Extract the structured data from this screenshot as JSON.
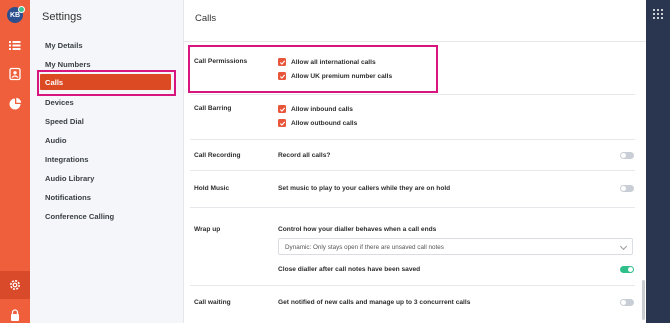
{
  "user": {
    "initials": "KB"
  },
  "rail": {
    "icons": [
      "list-icon",
      "contacts-icon",
      "analytics-icon",
      "settings-icon",
      "lock-icon"
    ]
  },
  "sidebar": {
    "title": "Settings",
    "items": [
      {
        "label": "My Details"
      },
      {
        "label": "My Numbers"
      },
      {
        "label": "Calls",
        "active": true
      },
      {
        "label": "Devices"
      },
      {
        "label": "Speed Dial"
      },
      {
        "label": "Audio"
      },
      {
        "label": "Integrations"
      },
      {
        "label": "Audio Library"
      },
      {
        "label": "Notifications"
      },
      {
        "label": "Conference Calling"
      }
    ]
  },
  "main": {
    "title": "Calls",
    "sections": {
      "permissions": {
        "label": "Call Permissions",
        "options": [
          {
            "label": "Allow all international calls",
            "checked": true
          },
          {
            "label": "Allow UK premium number calls",
            "checked": true
          }
        ]
      },
      "barring": {
        "label": "Call Barring",
        "options": [
          {
            "label": "Allow inbound calls",
            "checked": true
          },
          {
            "label": "Allow outbound calls",
            "checked": true
          }
        ]
      },
      "recording": {
        "label": "Call Recording",
        "description": "Record all calls?",
        "enabled": false
      },
      "hold_music": {
        "label": "Hold Music",
        "description": "Set music to play to your callers while they are on hold",
        "enabled": false
      },
      "wrap_up": {
        "label": "Wrap up",
        "description": "Control how your dialler behaves when a call ends",
        "select_value": "Dynamic: Only stays open if there are unsaved call notes",
        "close_label": "Close dialler after call notes have been saved",
        "close_enabled": true
      },
      "call_waiting": {
        "label": "Call waiting",
        "description": "Get notified of new calls and manage up to 3 concurrent calls",
        "enabled": false
      }
    }
  },
  "colors": {
    "rail": "#ef5f3c",
    "active_nav": "#dc4a24",
    "highlight": "#d8157f",
    "checkbox": "#e8553a",
    "toggle_on": "#2fbf8a",
    "toggle_off": "#c9ced6",
    "right_strip": "#2a3550"
  }
}
